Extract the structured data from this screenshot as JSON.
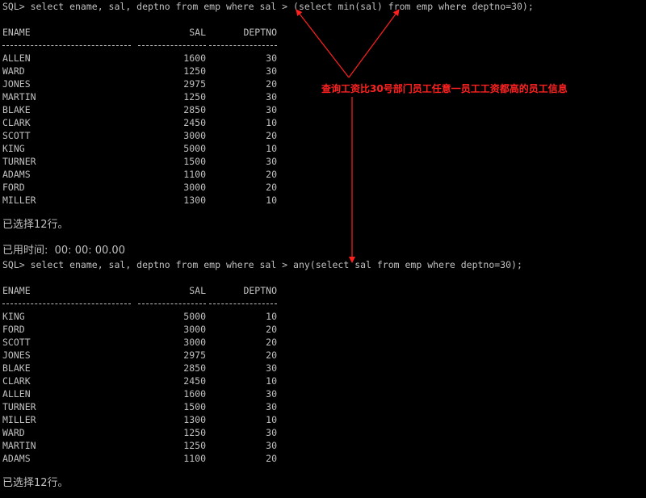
{
  "query1": {
    "prompt": "SQL> ",
    "command": "select ename, sal, deptno from emp where sal > (select min(sal) from emp where deptno=30);"
  },
  "result1": {
    "headers": [
      "ENAME",
      "SAL",
      "DEPTNO"
    ],
    "rows": [
      [
        "ALLEN",
        "1600",
        "30"
      ],
      [
        "WARD",
        "1250",
        "30"
      ],
      [
        "JONES",
        "2975",
        "20"
      ],
      [
        "MARTIN",
        "1250",
        "30"
      ],
      [
        "BLAKE",
        "2850",
        "30"
      ],
      [
        "CLARK",
        "2450",
        "10"
      ],
      [
        "SCOTT",
        "3000",
        "20"
      ],
      [
        "KING",
        "5000",
        "10"
      ],
      [
        "TURNER",
        "1500",
        "30"
      ],
      [
        "ADAMS",
        "1100",
        "20"
      ],
      [
        "FORD",
        "3000",
        "20"
      ],
      [
        "MILLER",
        "1300",
        "10"
      ]
    ],
    "rows_selected": "已选择12行。",
    "elapsed": "已用时间:  00: 00: 00.00"
  },
  "query2": {
    "prompt": "SQL> ",
    "command": "select ename, sal, deptno from emp where sal > any(select sal from emp where deptno=30);"
  },
  "result2": {
    "headers": [
      "ENAME",
      "SAL",
      "DEPTNO"
    ],
    "rows": [
      [
        "KING",
        "5000",
        "10"
      ],
      [
        "FORD",
        "3000",
        "20"
      ],
      [
        "SCOTT",
        "3000",
        "20"
      ],
      [
        "JONES",
        "2975",
        "20"
      ],
      [
        "BLAKE",
        "2850",
        "30"
      ],
      [
        "CLARK",
        "2450",
        "10"
      ],
      [
        "ALLEN",
        "1600",
        "30"
      ],
      [
        "TURNER",
        "1500",
        "30"
      ],
      [
        "MILLER",
        "1300",
        "10"
      ],
      [
        "WARD",
        "1250",
        "30"
      ],
      [
        "MARTIN",
        "1250",
        "30"
      ],
      [
        "ADAMS",
        "1100",
        "20"
      ]
    ],
    "rows_selected": "已选择12行。"
  },
  "annotation": {
    "text": "查询工资比30号部门员工任意一员工工资都高的员工信息",
    "color": "#ff2020"
  },
  "colors": {
    "background": "#000000",
    "foreground": "#c0c0c0",
    "annotation": "#ff2020"
  }
}
